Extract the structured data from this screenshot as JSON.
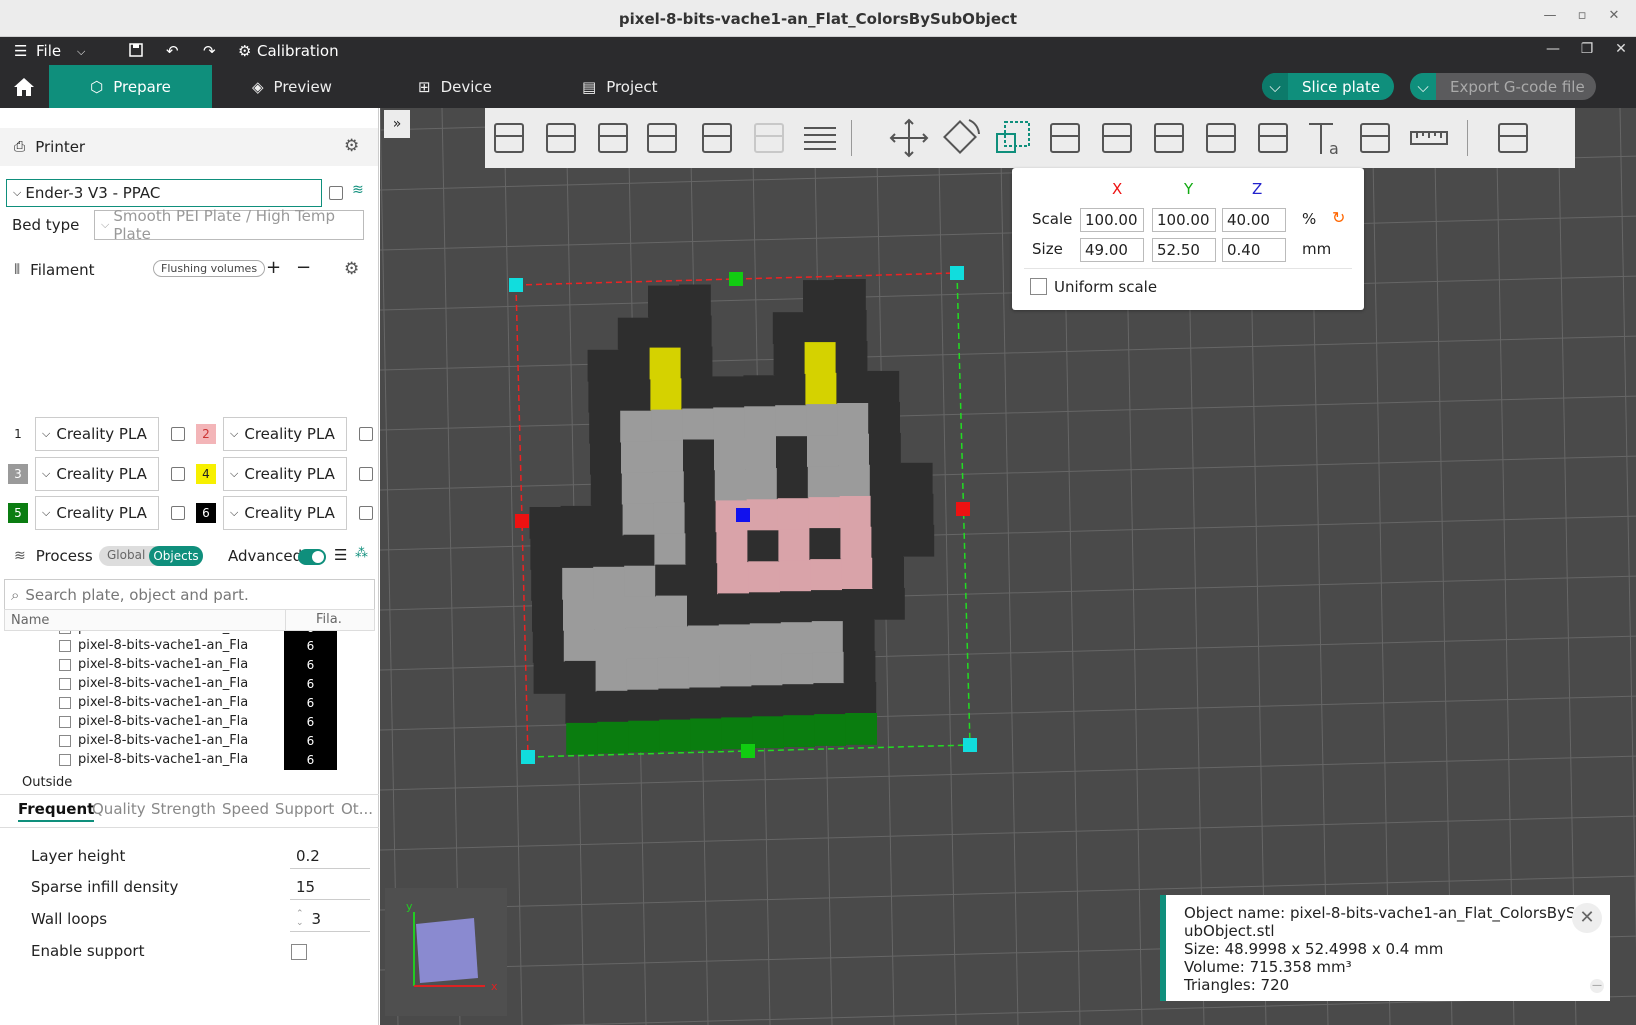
{
  "window": {
    "title": "pixel-8-bits-vache1-an_Flat_ColorsBySubObject"
  },
  "menubar": {
    "file_label": "File",
    "calibration_label": "Calibration"
  },
  "tabs": [
    {
      "label": "Prepare",
      "active": true
    },
    {
      "label": "Preview",
      "active": false
    },
    {
      "label": "Device",
      "active": false
    },
    {
      "label": "Project",
      "active": false
    }
  ],
  "actions": {
    "slice_label": "Slice plate",
    "export_label": "Export G-code file"
  },
  "printer": {
    "section_label": "Printer",
    "name": "Ender-3 V3 - PPAC",
    "bed_type_label": "Bed type",
    "bed_type_value": "Smooth PEI Plate / High Temp Plate"
  },
  "filament": {
    "section_label": "Filament",
    "flushing_label": "Flushing volumes",
    "slots": [
      {
        "num": "1",
        "name": "Creality  PLA",
        "color": "#ffffff"
      },
      {
        "num": "2",
        "name": "Creality  PLA",
        "color": "#f3b5b8"
      },
      {
        "num": "3",
        "name": "Creality  PLA",
        "color": "#9a9a9a"
      },
      {
        "num": "4",
        "name": "Creality  PLA",
        "color": "#f7f000"
      },
      {
        "num": "5",
        "name": "Creality  PLA",
        "color": "#0b7d12"
      },
      {
        "num": "6",
        "name": "Creality  PLA",
        "color": "#000000"
      }
    ]
  },
  "process": {
    "section_label": "Process",
    "global_label": "Global",
    "objects_label": "Objects",
    "advanced_label": "Advanced",
    "search_placeholder": "Search plate, object and part.",
    "col_name": "Name",
    "col_fila": "Fila.",
    "tree_rows": [
      {
        "name": "pixel-8-bits-vache1-an_Fla",
        "fila": "6"
      },
      {
        "name": "pixel-8-bits-vache1-an_Fla",
        "fila": "6"
      },
      {
        "name": "pixel-8-bits-vache1-an_Fla",
        "fila": "6"
      },
      {
        "name": "pixel-8-bits-vache1-an_Fla",
        "fila": "6"
      },
      {
        "name": "pixel-8-bits-vache1-an_Fla",
        "fila": "6"
      },
      {
        "name": "pixel-8-bits-vache1-an_Fla",
        "fila": "6"
      },
      {
        "name": "pixel-8-bits-vache1-an_Fla",
        "fila": "6"
      },
      {
        "name": "pixel-8-bits-vache1-an_Fla",
        "fila": "6"
      }
    ],
    "outside_label": "Outside",
    "subtabs": [
      "Frequent",
      "Quality",
      "Strength",
      "Speed",
      "Support",
      "Ot..."
    ],
    "params": [
      {
        "label": "Layer height",
        "value": "0.2"
      },
      {
        "label": "Sparse infill density",
        "value": "15"
      },
      {
        "label": "Wall loops",
        "value": "3"
      },
      {
        "label": "Enable support",
        "value": ""
      }
    ]
  },
  "scale_panel": {
    "x_label": "X",
    "y_label": "Y",
    "z_label": "Z",
    "scale_label": "Scale",
    "size_label": "Size",
    "scale_x": "100.00",
    "scale_y": "100.00",
    "scale_z": "40.00",
    "scale_unit": "%",
    "size_x": "49.00",
    "size_y": "52.50",
    "size_z": "0.40",
    "size_unit": "mm",
    "uniform_label": "Uniform scale"
  },
  "info": {
    "line1": "Object name: pixel-8-bits-vache1-an_Flat_ColorsByS",
    "line2": "ubObject.stl",
    "line3": "Size: 48.9998 x 52.4998 x 0.4 mm",
    "line4": "Volume: 715.358 mm³",
    "line5": "Triangles: 720"
  },
  "colors": {
    "accent": "#0f8f7c",
    "viewport_bg": "#4a4a4a"
  }
}
